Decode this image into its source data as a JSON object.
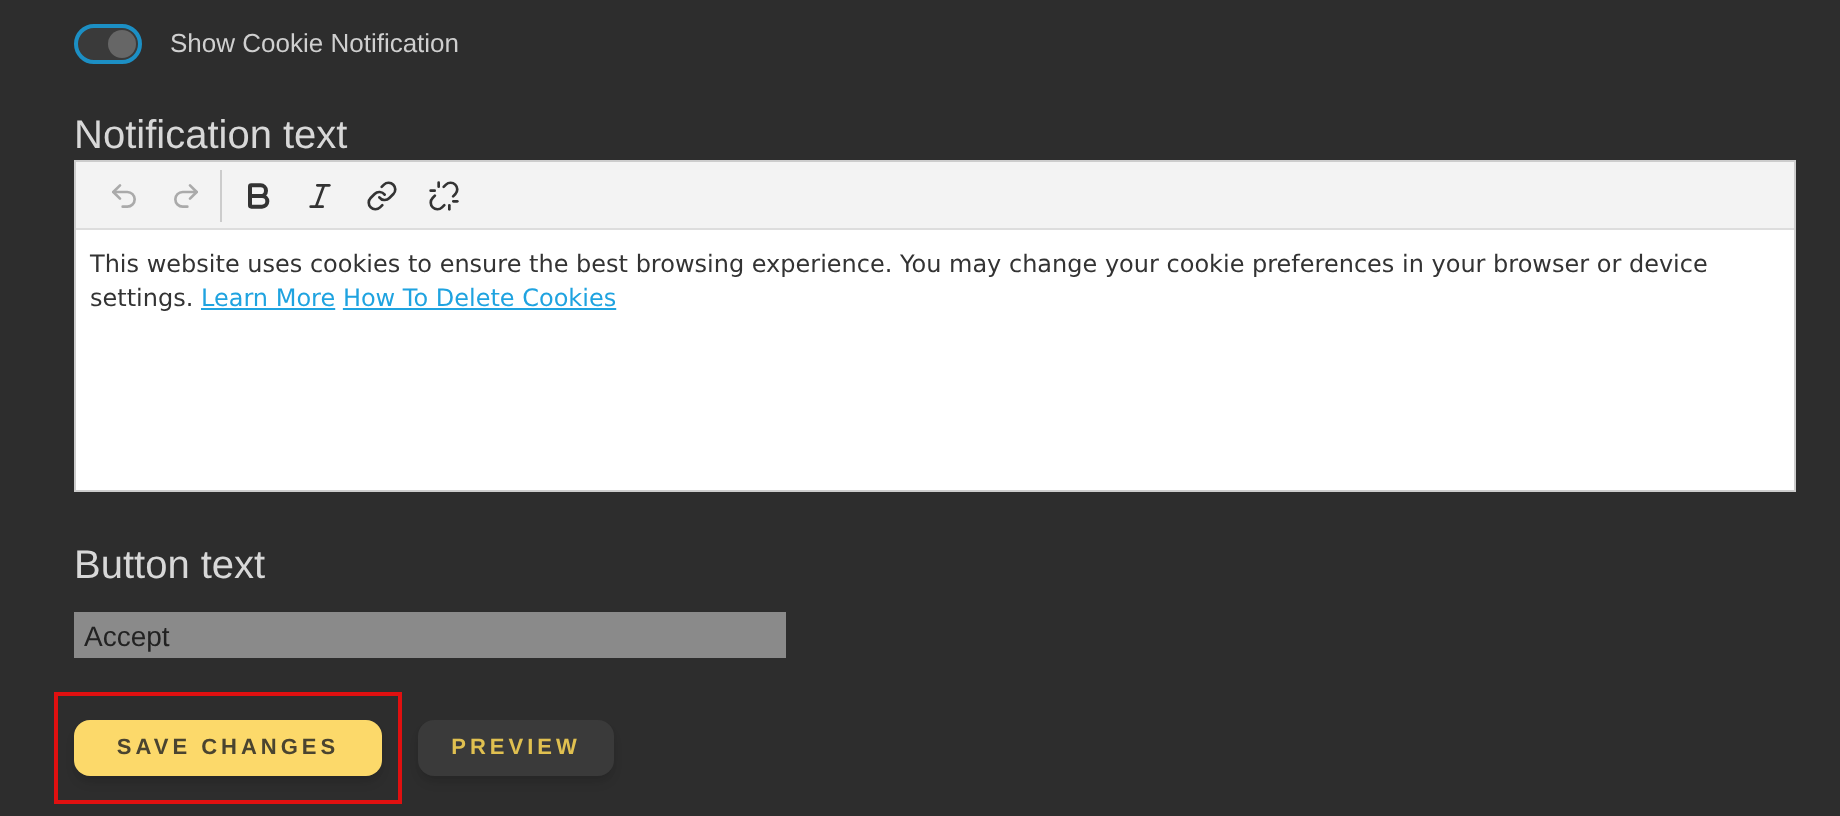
{
  "toggle": {
    "label": "Show Cookie Notification",
    "on": true
  },
  "notification": {
    "heading": "Notification text",
    "toolbar": [
      {
        "kind": "undo",
        "disabled": true
      },
      {
        "kind": "redo",
        "disabled": true
      },
      {
        "kind": "bold",
        "disabled": false
      },
      {
        "kind": "italic",
        "disabled": false
      },
      {
        "kind": "link",
        "disabled": false
      },
      {
        "kind": "unlink",
        "disabled": false
      }
    ],
    "text": "This website uses cookies to ensure the best browsing experience. You may change your cookie preferences in your browser or device settings.",
    "links": [
      "Learn More",
      "How To Delete Cookies"
    ]
  },
  "button_text": {
    "heading": "Button text",
    "value": "Accept"
  },
  "actions": [
    {
      "label": "SAVE CHANGES",
      "kind": "primary",
      "highlighted": true
    },
    {
      "label": "PREVIEW",
      "kind": "secondary",
      "highlighted": false
    }
  ]
}
